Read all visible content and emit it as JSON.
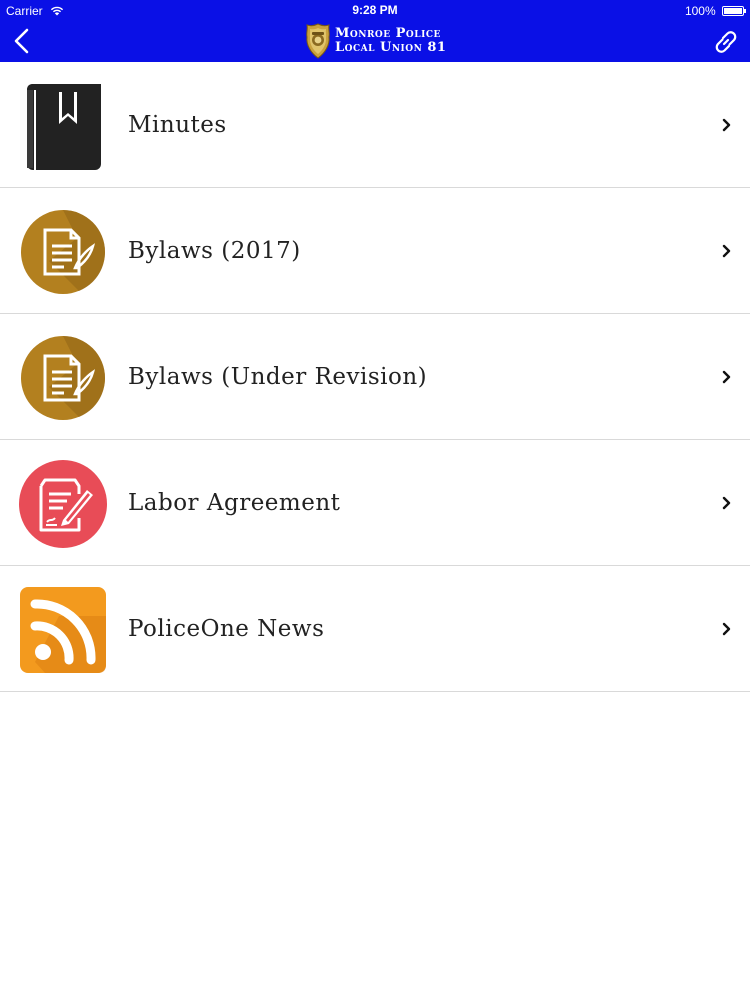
{
  "status_bar": {
    "carrier": "Carrier",
    "time": "9:28 PM",
    "battery": "100%"
  },
  "nav": {
    "title_line1": "Monroe Police",
    "title_line2": "Local Union 81",
    "back_icon": "chevron-left-icon",
    "right_icon": "link-icon",
    "bar_color": "#0a10e6"
  },
  "menu": {
    "items": [
      {
        "label": "Minutes",
        "icon": "book-bookmark-icon"
      },
      {
        "label": "Bylaws (2017)",
        "icon": "document-quill-icon"
      },
      {
        "label": "Bylaws (Under Revision)",
        "icon": "document-quill-icon"
      },
      {
        "label": "Labor Agreement",
        "icon": "contract-pen-icon"
      },
      {
        "label": "PoliceOne News",
        "icon": "rss-feed-icon"
      }
    ]
  },
  "colors": {
    "bylaws_gold": "#b3801f",
    "labor_red": "#e84c57",
    "rss_orange": "#f39a1e",
    "book_dark": "#222222"
  }
}
